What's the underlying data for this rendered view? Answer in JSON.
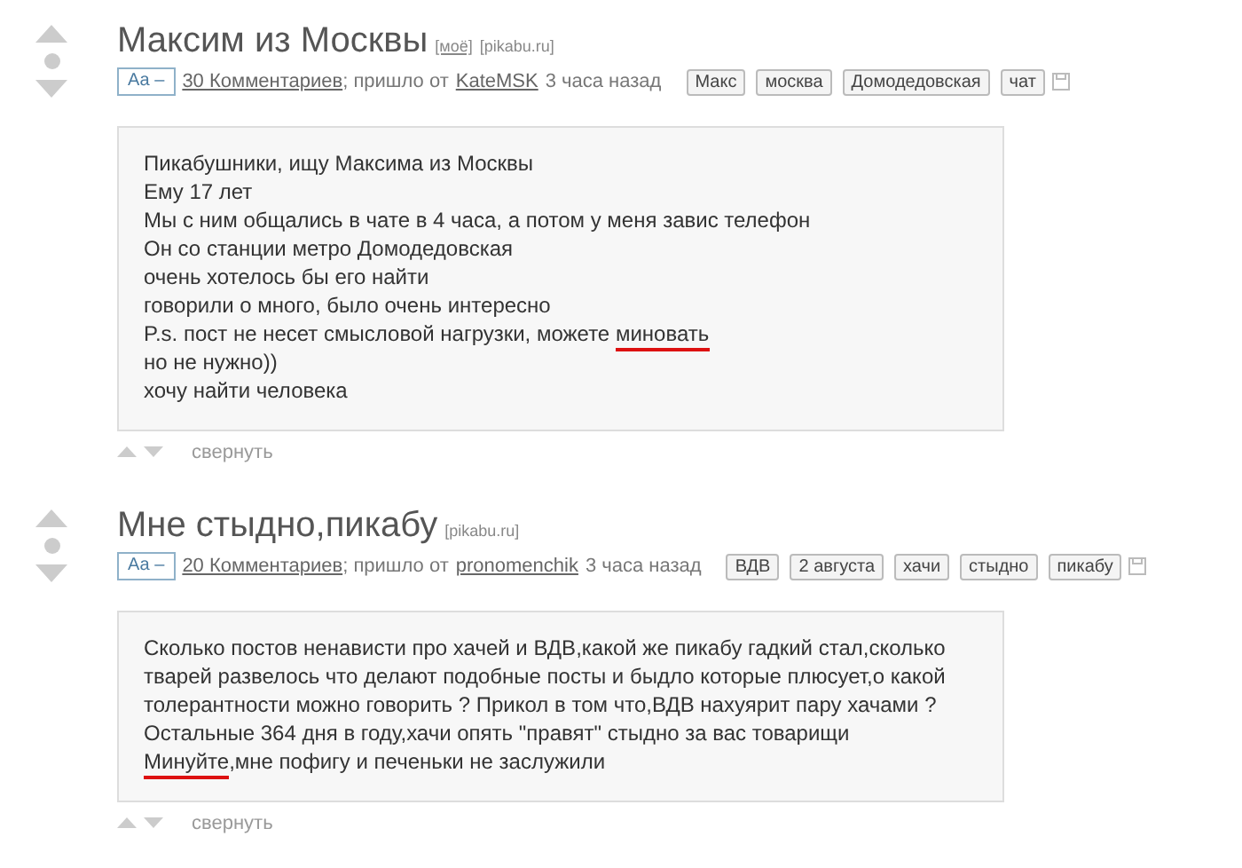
{
  "posts": [
    {
      "title": "Максим из Москвы",
      "title_links": [
        "[моё]",
        "[pikabu.ru]"
      ],
      "font_toggle": "Аа –",
      "comments": "30 Комментариев",
      "from_text": "; пришло от",
      "author": "KateMSK",
      "time": "3 часа назад",
      "tags": [
        "Макс",
        "москва",
        "Домодедовская",
        "чат"
      ],
      "lines": [
        [
          {
            "text": "Пикабушники, ищу Максима из Москвы",
            "marked": false
          }
        ],
        [
          {
            "text": "Ему 17 лет",
            "marked": false
          }
        ],
        [
          {
            "text": "Мы с ним общались в чате в 4 часа, а потом у меня завис телефон",
            "marked": false
          }
        ],
        [
          {
            "text": "Он со станции метро Домодедовская",
            "marked": false
          }
        ],
        [
          {
            "text": "очень хотелось бы его найти",
            "marked": false
          }
        ],
        [
          {
            "text": "говорили о много, было очень интересно",
            "marked": false
          }
        ],
        [
          {
            "text": "P.s. пост не несет смысловой нагрузки, можете ",
            "marked": false
          },
          {
            "text": "миновать",
            "marked": true
          }
        ],
        [
          {
            "text": "но не нужно))",
            "marked": false
          }
        ],
        [
          {
            "text": "хочу найти человека",
            "marked": false
          }
        ]
      ],
      "collapse": "свернуть"
    },
    {
      "title": "Мне стыдно,пикабу",
      "title_links": [
        "[pikabu.ru]"
      ],
      "font_toggle": "Аа –",
      "comments": "20 Комментариев",
      "from_text": "; пришло от",
      "author": "pronomenchik",
      "time": "3 часа назад",
      "tags": [
        "ВДВ",
        "2 августа",
        "хачи",
        "стыдно",
        "пикабу"
      ],
      "lines": [
        [
          {
            "text": "Сколько постов ненависти про хачей и ВДВ,какой же пикабу гадкий стал,сколько тварей развелось что делают подобные посты и быдло которые плюсует,о какой толерантности можно говорить ? Прикол в том что,ВДВ нахуярит пару хачами ? Остальные 364 дня в году,хачи опять \"правят\" стыдно за вас товарищи",
            "marked": false
          }
        ],
        [
          {
            "text": "Минуйте",
            "marked": true
          },
          {
            "text": ",мне пофигу и печеньки не заслужили",
            "marked": false
          }
        ]
      ],
      "collapse": "свернуть"
    }
  ]
}
